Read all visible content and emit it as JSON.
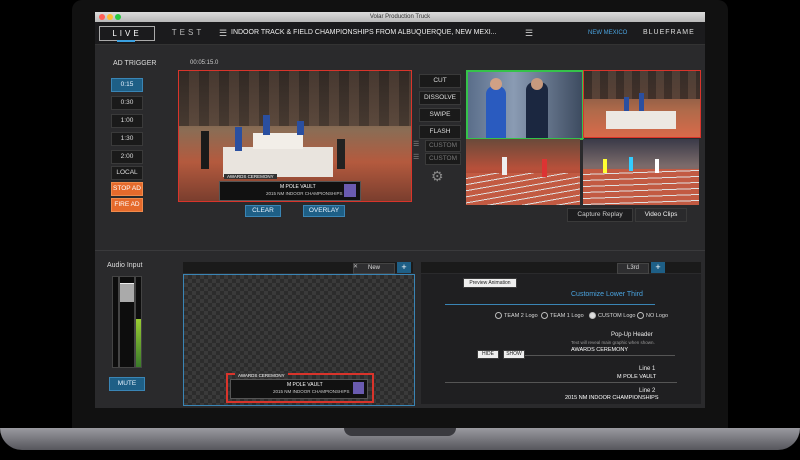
{
  "window_title": "Volar Production Truck",
  "app": {
    "brand_live": "LIVE",
    "brand_test": "TEST",
    "event_title": "INDOOR TRACK & FIELD CHAMPIONSHIPS FROM ALBUQUERQUE, NEW MEXI...",
    "location": "NEW MEXICO",
    "vendor": "BLUEFRAME"
  },
  "ad_trigger": {
    "title": "AD TRIGGER",
    "durations": [
      "0:15",
      "0:30",
      "1:00",
      "1:30",
      "2:00"
    ],
    "local": "LOCAL",
    "stop_ad": "STOP AD",
    "fire_ad": "FIRE AD"
  },
  "program": {
    "timecode": "00:05:15.0",
    "lower_third_line1": "AWARDS CEREMONY",
    "lower_third_line2": "M POLE VAULT",
    "lower_third_line3": "2015 NM INDOOR CHAMPIONSHIPS",
    "overlay_button": "OVERLAY",
    "clear_button": "CLEAR"
  },
  "transitions": [
    "CUT",
    "DISSOLVE",
    "SWIPE",
    "FLASH",
    "CUSTOM",
    "CUSTOM"
  ],
  "tabs": [
    "Video Clips",
    "Capture Replay"
  ],
  "audio": {
    "title": "Audio Input",
    "mute": "MUTE"
  },
  "preview": {
    "tab_label": "New",
    "lower_third_line1": "AWARDS CEREMONY",
    "lower_third_line2": "M POLE VAULT",
    "lower_third_line3": "2015 NM INDOOR CHAMPIONSHIPS"
  },
  "lower_third_editor": {
    "tab_label": "L3rd",
    "preview_animation": "Preview Animation",
    "heading": "Customize Lower Third",
    "logo_options": [
      "NO Logo",
      "CUSTOM Logo",
      "TEAM 1 Logo",
      "TEAM 2 Logo"
    ],
    "selected_logo": "CUSTOM Logo",
    "popup_header_label": "Pop-Up Header",
    "popup_header_hint": "Text will reveal main graphic when shown.",
    "popup_header_value": "AWARDS CEREMONY",
    "show": "SHOW",
    "hide": "HIDE",
    "line1_label": "Line 1",
    "line1_value": "M POLE VAULT",
    "line2_label": "Line 2",
    "line2_value": "2015 NM INDOOR CHAMPIONSHIPS"
  },
  "colors": {
    "accent_blue": "#1e5f86",
    "orange": "#e56a2c",
    "program_border": "#d9342b",
    "preview_border": "#35c24a"
  }
}
